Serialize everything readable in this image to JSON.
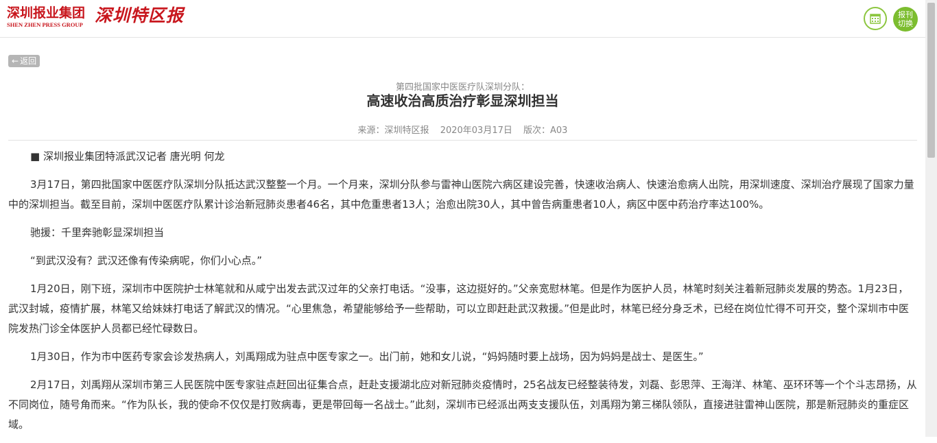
{
  "header": {
    "group_name_cn": "深圳报业集团",
    "group_name_en": "SHEN ZHEN PRESS GROUP",
    "paper_name": "深圳特区报",
    "calendar_icon": "calendar-icon",
    "switch_label": "报刊切换",
    "accent_color": "#7cbd2f",
    "brand_color": "#c8161d"
  },
  "nav": {
    "back_label": "返回",
    "back_icon": "arrow-left-icon"
  },
  "article": {
    "subtitle": "第四批国家中医医疗队深圳分队：",
    "title": "高速收治高质治疗彰显深圳担当",
    "source": "来源：深圳特区报",
    "date": "2020年03月17日",
    "edition": "版次：A03",
    "paragraphs": [
      "■ 深圳报业集团特派武汉记者 唐光明 何龙",
      "3月17日，第四批国家中医医疗队深圳分队抵达武汉整整一个月。一个月来，深圳分队参与雷神山医院六病区建设完善，快速收治病人、快速治愈病人出院，用深圳速度、深圳治疗展现了国家力量中的深圳担当。截至目前，深圳中医医疗队累计诊治新冠肺炎患者46名，其中危重患者13人；治愈出院30人，其中曾告病重患者10人，病区中医中药治疗率达100%。",
      "驰援：千里奔驰彰显深圳担当",
      "“到武汉没有？武汉还像有传染病呢，你们小心点。”",
      "1月20日，刚下班，深圳市中医院护士林笔就和从咸宁出发去武汉过年的父亲打电话。“没事，这边挺好的。”父亲宽慰林笔。但是作为医护人员，林笔时刻关注着新冠肺炎发展的势态。1月23日，武汉封城，疫情扩展，林笔又给妹妹打电话了解武汉的情况。“心里焦急，希望能够给予一些帮助，可以立即赶赴武汉救援。”但是此时，林笔已经分身乏术，已经在岗位忙得不可开交，整个深圳市中医院发热门诊全体医护人员都已经忙碌数日。",
      "1月30日，作为市中医药专家会诊发热病人，刘禹翔成为驻点中医专家之一。出门前，她和女儿说，“妈妈随时要上战场，因为妈妈是战士、是医生。”",
      "2月17日，刘禹翔从深圳市第三人民医院中医专家驻点赶回出征集合点，赶赴支援湖北应对新冠肺炎疫情时，25名战友已经整装待发，刘磊、彭思萍、王海洋、林笔、巫环环等一个个斗志昂扬，从不同岗位，随号角而来。“作为队长，我的使命不仅仅是打败病毒，更是带回每一名战士。”此刻，深圳市已经派出两支支援队伍，刘禹翔为第三梯队领队，直接进驻雷神山医院，那是新冠肺炎的重症区域。"
    ]
  }
}
